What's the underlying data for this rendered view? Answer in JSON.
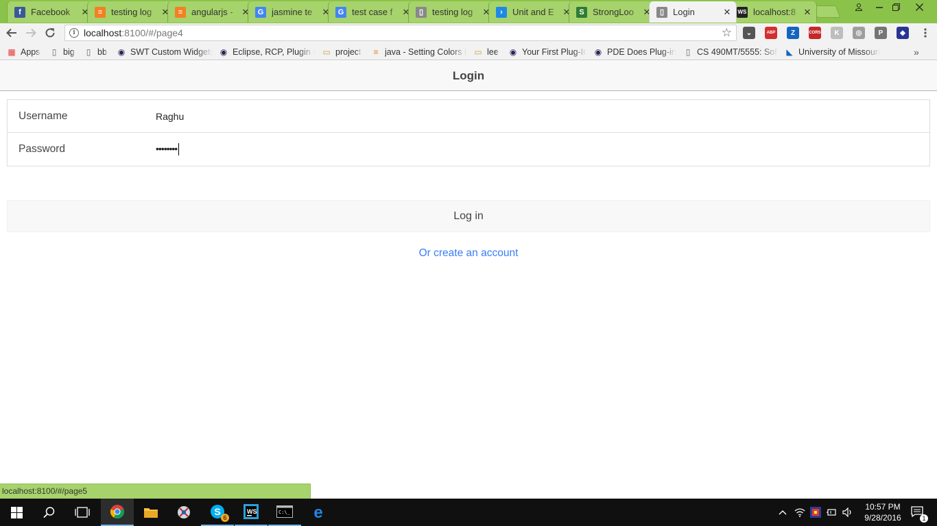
{
  "browser": {
    "tabs": [
      {
        "title": "Facebook",
        "icon": "facebook-icon",
        "color": "#3b5998",
        "glyph": "f"
      },
      {
        "title": "testing log",
        "icon": "stackoverflow-icon",
        "color": "#f48024",
        "glyph": "≡"
      },
      {
        "title": "angularjs -",
        "icon": "stackoverflow-icon",
        "color": "#f48024",
        "glyph": "≡"
      },
      {
        "title": "jasmine te",
        "icon": "google-icon",
        "color": "#4285f4",
        "glyph": "G"
      },
      {
        "title": "test case f",
        "icon": "google-icon",
        "color": "#4285f4",
        "glyph": "G"
      },
      {
        "title": "testing log",
        "icon": "page-icon",
        "color": "#888888",
        "glyph": "▯"
      },
      {
        "title": "Unit and E",
        "icon": "angular-icon",
        "color": "#1e88e5",
        "glyph": "›"
      },
      {
        "title": "StrongLoo",
        "icon": "strongloop-icon",
        "color": "#2e7d32",
        "glyph": "S"
      },
      {
        "title": "Login",
        "icon": "page-icon",
        "color": "#888888",
        "glyph": "▯"
      },
      {
        "title": "localhost:8",
        "icon": "webstorm-icon",
        "color": "#222222",
        "glyph": "WS"
      }
    ],
    "active_tab": 8,
    "address": {
      "host": "localhost",
      "path": ":8100/#/page4"
    },
    "bookmarks": [
      {
        "label": "Apps",
        "icon": "apps-grid-icon"
      },
      {
        "label": "big",
        "icon": "page-icon"
      },
      {
        "label": "bb",
        "icon": "page-icon"
      },
      {
        "label": "SWT Custom Widgets",
        "icon": "eclipse-icon"
      },
      {
        "label": "Eclipse, RCP, Plugin ar",
        "icon": "eclipse-icon"
      },
      {
        "label": "project",
        "icon": "folder-icon"
      },
      {
        "label": "java - Setting Colors ir",
        "icon": "stackoverflow-icon"
      },
      {
        "label": "lee",
        "icon": "folder-icon"
      },
      {
        "label": "Your First Plug-In",
        "icon": "eclipse-icon"
      },
      {
        "label": "PDE Does Plug-ins",
        "icon": "eclipse-icon"
      },
      {
        "label": "CS 490MT/5555: Softw",
        "icon": "page-icon"
      },
      {
        "label": "University of Missouri",
        "icon": "university-icon"
      }
    ],
    "extensions": [
      {
        "name": "pocket-icon",
        "glyph": "⌄",
        "color": "#555555"
      },
      {
        "name": "adblock-plus-icon",
        "glyph": "ABP",
        "color": "#d32f2f"
      },
      {
        "name": "zotero-icon",
        "glyph": "Z",
        "color": "#1565c0"
      },
      {
        "name": "cors-icon",
        "glyph": "CORS",
        "color": "#c62828"
      },
      {
        "name": "extension-k-icon",
        "glyph": "K",
        "color": "#bdbdbd"
      },
      {
        "name": "camera-icon",
        "glyph": "◎",
        "color": "#9e9e9e"
      },
      {
        "name": "pinterest-p-icon",
        "glyph": "P",
        "color": "#757575"
      },
      {
        "name": "extension-purple-icon",
        "glyph": "◆",
        "color": "#283593"
      }
    ],
    "status_url": "localhost:8100/#/page5"
  },
  "app": {
    "title": "Login",
    "username_label": "Username",
    "username_value": "Raghu",
    "password_label": "Password",
    "password_value": "••••••••",
    "login_button": "Log in",
    "create_account_link": "Or create an account"
  },
  "taskbar": {
    "time": "10:57 PM",
    "date": "9/28/2016",
    "skype_badge": "6",
    "notification_count": "1"
  }
}
